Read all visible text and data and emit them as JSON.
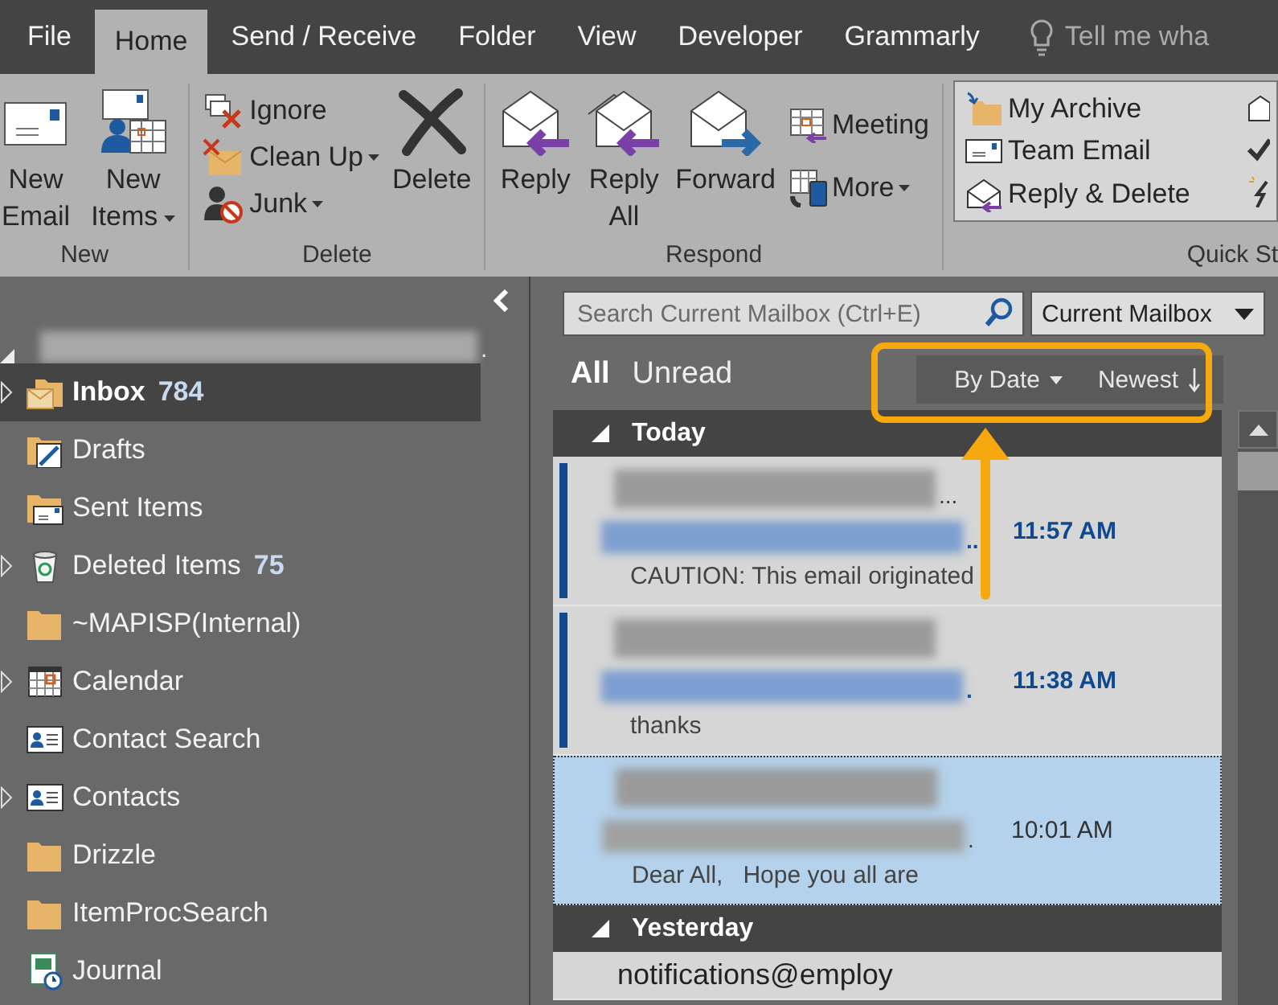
{
  "menu_tabs": [
    {
      "label": "File",
      "selected": false
    },
    {
      "label": "Home",
      "selected": true
    },
    {
      "label": "Send / Receive",
      "selected": false
    },
    {
      "label": "Folder",
      "selected": false
    },
    {
      "label": "View",
      "selected": false
    },
    {
      "label": "Developer",
      "selected": false
    },
    {
      "label": "Grammarly",
      "selected": false
    }
  ],
  "tell_me": {
    "placeholder": "Tell me wha"
  },
  "ribbon_groups": [
    {
      "label": "New",
      "buttons": [
        {
          "kind": "large",
          "label": "New Email",
          "dropdown": false
        },
        {
          "kind": "large",
          "label": "New Items",
          "dropdown": true
        }
      ]
    },
    {
      "label": "Delete",
      "buttons": [
        {
          "kind": "small",
          "label": "Ignore",
          "dropdown": false
        },
        {
          "kind": "small",
          "label": "Clean Up",
          "dropdown": true
        },
        {
          "kind": "small",
          "label": "Junk",
          "dropdown": true
        },
        {
          "kind": "large",
          "label": "Delete",
          "dropdown": false
        }
      ]
    },
    {
      "label": "Respond",
      "buttons": [
        {
          "kind": "large",
          "label": "Reply",
          "dropdown": false
        },
        {
          "kind": "large",
          "label": "Reply All",
          "dropdown": false
        },
        {
          "kind": "large",
          "label": "Forward",
          "dropdown": false
        },
        {
          "kind": "small",
          "label": "Meeting",
          "dropdown": false
        },
        {
          "kind": "small",
          "label": "More",
          "dropdown": true
        }
      ]
    }
  ],
  "quick_steps": {
    "label": "Quick St",
    "items": [
      "My Archive",
      "Team Email",
      "Reply & Delete"
    ]
  },
  "folder_pane": {
    "account_tail": ".",
    "folders": [
      {
        "kind": "inbox",
        "label": "Inbox",
        "count": "784",
        "expandable": true,
        "selected": true
      },
      {
        "kind": "drafts",
        "label": "Drafts",
        "expandable": false,
        "selected": false
      },
      {
        "kind": "sent",
        "label": "Sent Items",
        "expandable": false,
        "selected": false
      },
      {
        "kind": "deleted",
        "label": "Deleted Items",
        "count": "75",
        "expandable": true,
        "selected": false
      },
      {
        "kind": "folder",
        "label": "~MAPISP(Internal)",
        "expandable": false,
        "selected": false
      },
      {
        "kind": "calendar",
        "label": "Calendar",
        "expandable": true,
        "selected": false
      },
      {
        "kind": "contacts",
        "label": "Contact Search",
        "expandable": false,
        "selected": false
      },
      {
        "kind": "contacts",
        "label": "Contacts",
        "expandable": true,
        "selected": false
      },
      {
        "kind": "folder",
        "label": "Drizzle",
        "expandable": false,
        "selected": false
      },
      {
        "kind": "folder",
        "label": "ItemProcSearch",
        "expandable": false,
        "selected": false
      },
      {
        "kind": "journal",
        "label": "Journal",
        "expandable": false,
        "selected": false
      }
    ]
  },
  "search": {
    "placeholder": "Search Current Mailbox (Ctrl+E)",
    "scope": "Current Mailbox"
  },
  "filters": [
    {
      "label": "All",
      "selected": true
    },
    {
      "label": "Unread",
      "selected": false
    }
  ],
  "sort": {
    "field": "By Date",
    "order": "Newest"
  },
  "message_groups": [
    {
      "label": "Today",
      "expanded": true,
      "messages": [
        {
          "sender_tail": "...",
          "subject_tail": "..",
          "preview": "CAUTION: This email originated",
          "time": "11:57 AM",
          "unread": true,
          "selected": false
        },
        {
          "subject_tail": ".",
          "preview": "thanks",
          "time": "11:38 AM",
          "unread": true,
          "selected": false
        },
        {
          "subject_tail": ".",
          "preview": "Dear All,   Hope you all are",
          "time": "10:01 AM",
          "unread": false,
          "selected": true
        }
      ]
    },
    {
      "label": "Yesterday",
      "expanded": true,
      "messages": [
        {
          "sender": "notifications@employ",
          "unread": false,
          "selected": false
        }
      ]
    }
  ]
}
